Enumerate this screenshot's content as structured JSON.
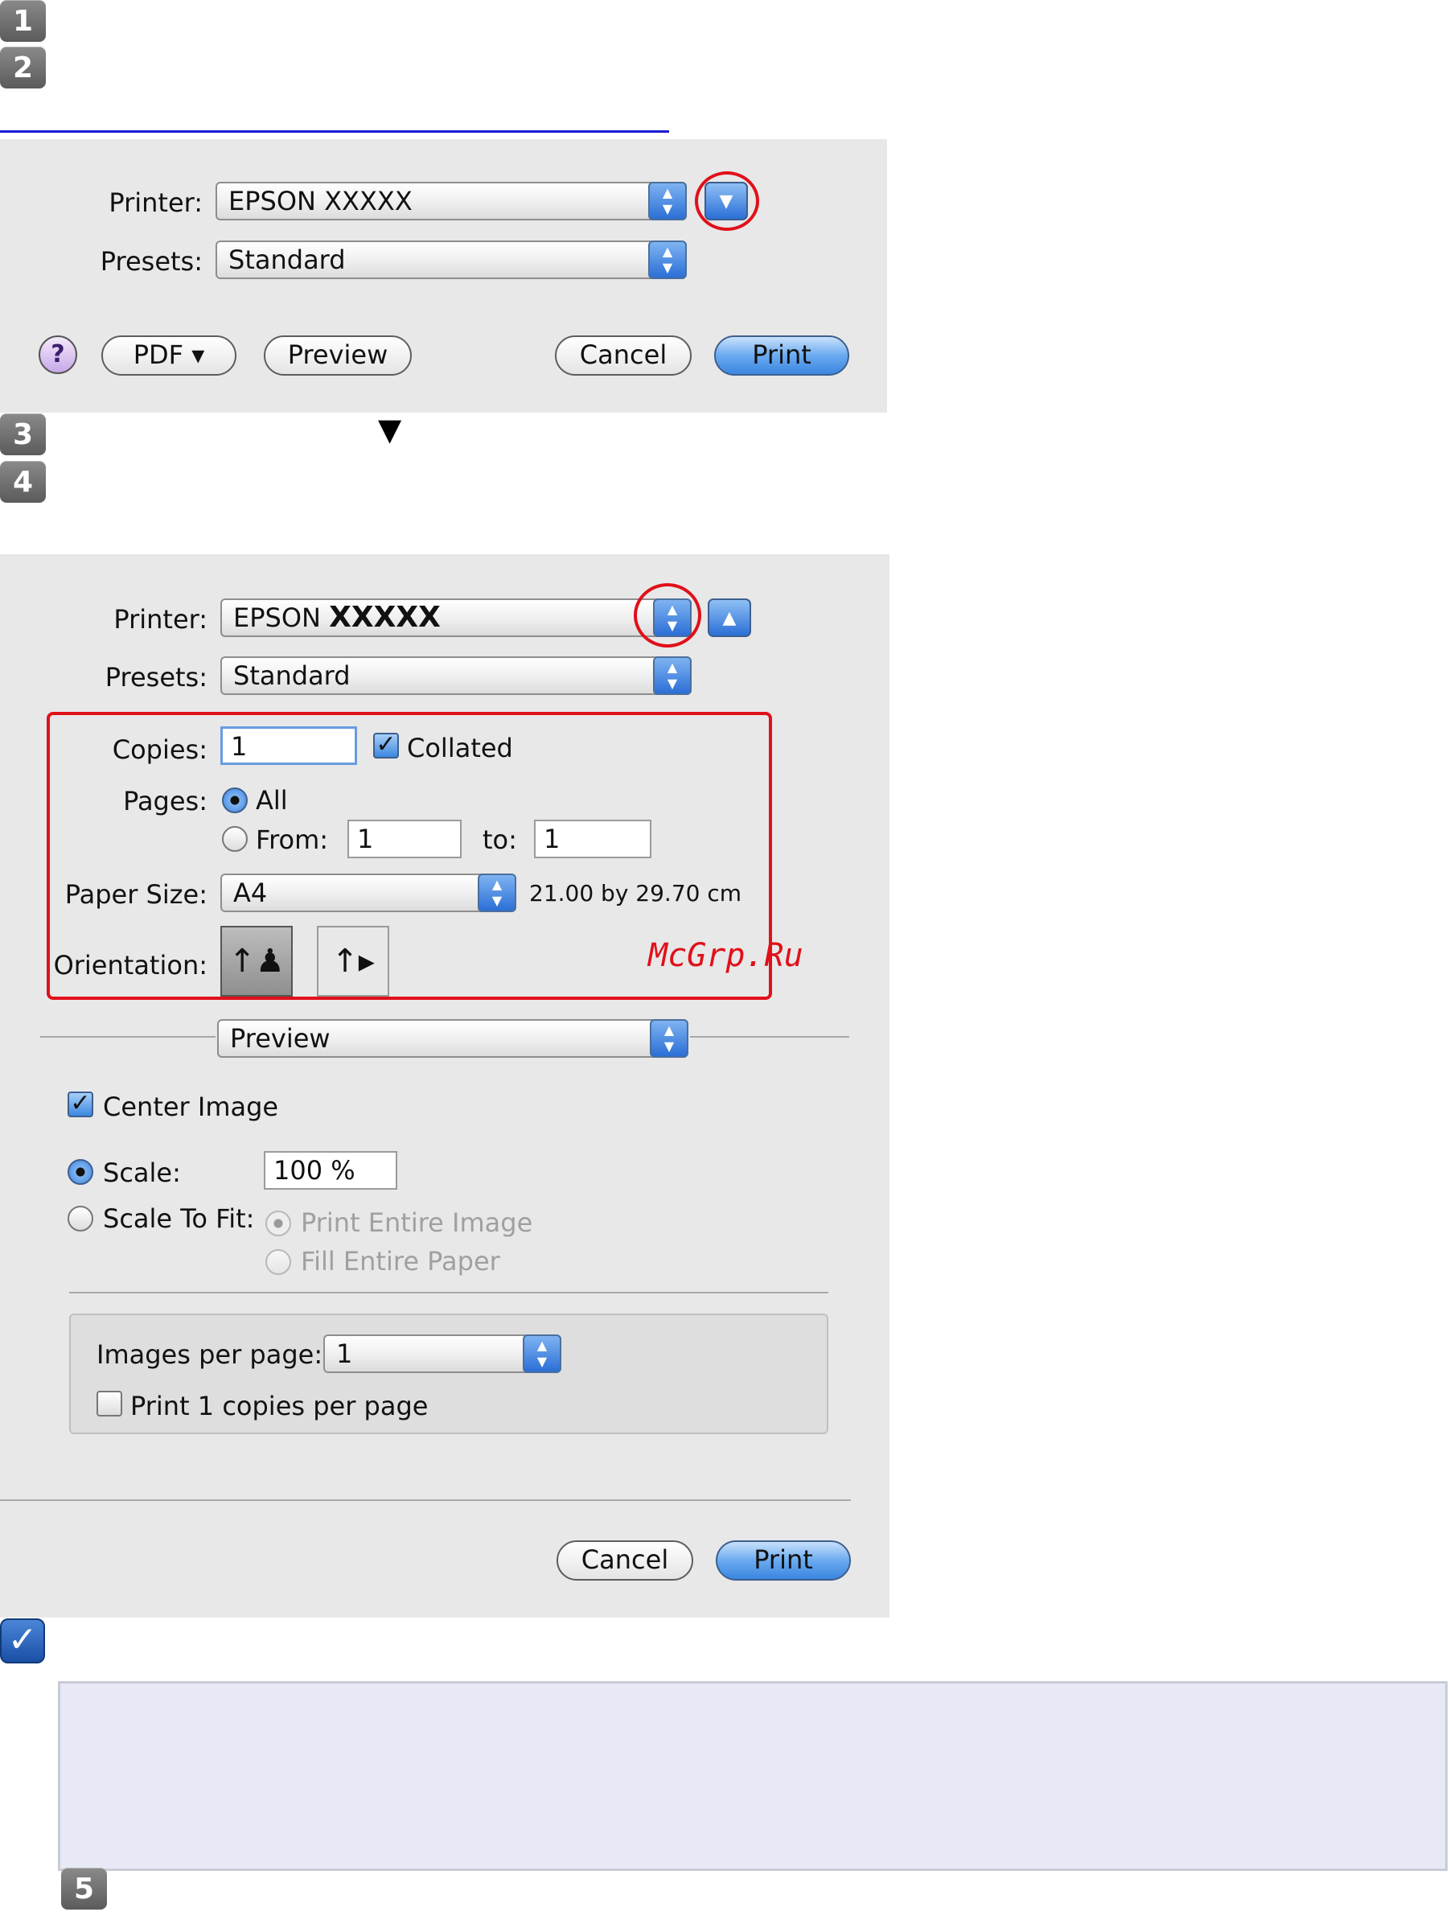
{
  "steps": {
    "s1": "1",
    "s2": "2",
    "s3": "3",
    "s4": "4",
    "s5": "5"
  },
  "collapsed_dialog": {
    "printer_label": "Printer:",
    "printer_value": "EPSON XXXXX",
    "presets_label": "Presets:",
    "presets_value": "Standard",
    "help_label": "?",
    "pdf_label": "PDF ▾",
    "preview_label": "Preview",
    "cancel_label": "Cancel",
    "print_label": "Print"
  },
  "step3_marker": "▼",
  "expanded_dialog": {
    "printer_label": "Printer:",
    "printer_value_prefix": "EPSON",
    "printer_value_model": "XXXXX",
    "presets_label": "Presets:",
    "presets_value": "Standard",
    "copies_label": "Copies:",
    "copies_value": "1",
    "collated_label": "Collated",
    "pages_label": "Pages:",
    "pages_all": "All",
    "pages_from": "From:",
    "from_value": "1",
    "to_label": "to:",
    "to_value": "1",
    "paper_size_label": "Paper Size:",
    "paper_size_value": "A4",
    "paper_dimensions": "21.00 by 29.70 cm",
    "orientation_label": "Orientation:",
    "section_value": "Preview",
    "center_image": "Center Image",
    "scale_label": "Scale:",
    "scale_value": "100 %",
    "scale_to_fit_label": "Scale To Fit:",
    "print_entire_image": "Print Entire Image",
    "fill_entire_paper": "Fill Entire Paper",
    "images_per_page_label": "Images per page:",
    "images_per_page_value": "1",
    "print_copies_per_page": "Print 1 copies per page",
    "cancel_label": "Cancel",
    "print_label": "Print"
  },
  "watermark": "McGrp.Ru",
  "colors": {
    "highlight": "#e0101a",
    "accent": "#3b86e0",
    "note_bg": "#e7e9f6",
    "rule": "#1a1ad8"
  }
}
